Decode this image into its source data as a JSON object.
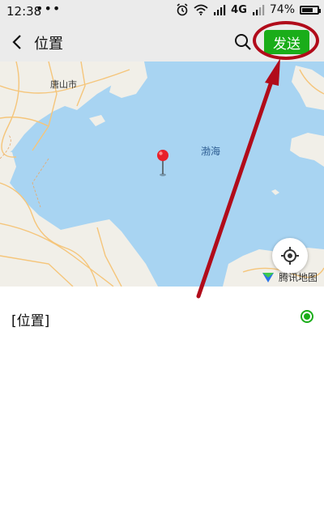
{
  "status_bar": {
    "time": "12:38",
    "dots": "•••",
    "network": "4G",
    "battery": "74%",
    "battery_level": 0.74,
    "icons": [
      "alarm-icon",
      "wifi-icon",
      "signal-icon",
      "signal-icon",
      "battery-icon"
    ]
  },
  "header": {
    "title": "位置",
    "send_label": "发送",
    "back_icon": "chevron-left-icon",
    "search_icon": "search-icon"
  },
  "map": {
    "city_label": "唐山市",
    "sea_label": "渤海",
    "logo_text": "腾讯地图",
    "colors": {
      "water": "#a8d4f2",
      "land": "#f1efe8",
      "road": "#f5c57a",
      "pin": "#e8202a"
    }
  },
  "location": {
    "label": "[位置]",
    "selected": true
  },
  "colors": {
    "accent": "#1aad19",
    "annotation": "#b10b1a",
    "header_bg": "#ebebeb"
  }
}
